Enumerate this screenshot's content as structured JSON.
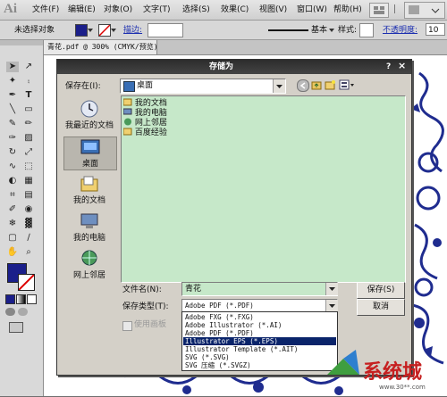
{
  "app": {
    "logo": "Ai"
  },
  "menu": [
    "文件(F)",
    "编辑(E)",
    "对象(O)",
    "文字(T)",
    "选择(S)",
    "效果(C)",
    "视图(V)",
    "窗口(W)",
    "帮助(H)"
  ],
  "controlbar": {
    "selection": "未选择对象",
    "stroke_label": "描边:",
    "brush_label": "基本",
    "style_label": "样式:",
    "opacity_label": "不透明度:",
    "opacity_value": "10"
  },
  "document_tab": "青花.pdf @ 300% (CMYK/预览)",
  "dialog": {
    "title": "存储为",
    "help": "?",
    "close": "×",
    "save_in_label": "保存在(I):",
    "save_in_value": "桌面",
    "places": [
      {
        "label": "我最近的文档",
        "icon": "recent-docs-icon"
      },
      {
        "label": "桌面",
        "icon": "desktop-icon"
      },
      {
        "label": "我的文档",
        "icon": "my-documents-icon"
      },
      {
        "label": "我的电脑",
        "icon": "my-computer-icon"
      },
      {
        "label": "网上邻居",
        "icon": "network-icon"
      }
    ],
    "files": [
      "我的文档",
      "我的电脑",
      "网上邻居",
      "百度经验"
    ],
    "filename_label": "文件名(N):",
    "filename_value": "青花",
    "filetype_label": "保存类型(T):",
    "filetype_value": "Adobe PDF (*.PDF)",
    "filetype_options": [
      "Adobe FXG (*.FXG)",
      "Adobe Illustrator (*.AI)",
      "Adobe PDF (*.PDF)",
      "Illustrator EPS (*.EPS)",
      "Illustrator Template (*.AIT)",
      "SVG (*.SVG)",
      "SVG 压缩 (*.SVGZ)"
    ],
    "filetype_selected_index": 3,
    "use_artboards_label": "使用画板",
    "save_button": "保存(S)",
    "cancel_button": "取消"
  },
  "watermark": {
    "brand": "系统城",
    "url": "www.30**.com"
  },
  "colors": {
    "fill_swatch": "#1b1f8a",
    "list_bg": "#c6e8c9",
    "dialog_bg": "#d4d0c8",
    "title_bar": "#333333",
    "selection": "#0a246a",
    "pattern_blue": "#1f2c8f"
  }
}
